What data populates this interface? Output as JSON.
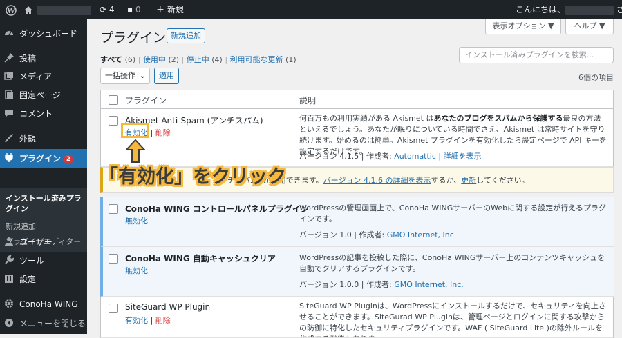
{
  "admin_bar": {
    "updates_count": "4",
    "comments_count": "0",
    "new_label": "新規",
    "greeting": "こんにちは、",
    "honorific": "さん"
  },
  "sidebar": {
    "items": [
      {
        "label": "ダッシュボード",
        "icon": "dashboard-icon"
      },
      {
        "label": "投稿",
        "icon": "pin-icon"
      },
      {
        "label": "メディア",
        "icon": "media-icon"
      },
      {
        "label": "固定ページ",
        "icon": "page-icon"
      },
      {
        "label": "コメント",
        "icon": "comment-icon"
      },
      {
        "label": "外観",
        "icon": "brush-icon"
      },
      {
        "label": "プラグイン",
        "icon": "plugin-icon",
        "badge": "2"
      },
      {
        "label": "ユーザー",
        "icon": "user-icon"
      },
      {
        "label": "ツール",
        "icon": "wrench-icon"
      },
      {
        "label": "設定",
        "icon": "settings-icon"
      },
      {
        "label": "ConoHa WING",
        "icon": "gear-icon"
      },
      {
        "label": "メニューを閉じる",
        "icon": "collapse-icon"
      }
    ],
    "submenu": [
      "インストール済みプラグイン",
      "新規追加",
      "プラグインエディター"
    ]
  },
  "page": {
    "title": "プラグイン",
    "add_new": "新規追加",
    "screen_options": "表示オプション ▼",
    "help": "ヘルプ ▼",
    "search_placeholder": "インストール済みプラグインを検索...",
    "filters": {
      "all": "すべて",
      "all_count": "(6)",
      "active": "使用中",
      "active_count": "(2)",
      "inactive": "停止中",
      "inactive_count": "(4)",
      "updates": "利用可能な更新",
      "updates_count": "(1)"
    },
    "bulk_action": "一括操作",
    "apply": "適用",
    "item_count": "6個の項目"
  },
  "table": {
    "col_plugin": "プラグイン",
    "col_desc": "説明",
    "rows": [
      {
        "name": "Akismet Anti-Spam (アンチスパム)",
        "action": "有効化",
        "delete": "削除",
        "desc_pre": "何百万もの利用実績がある Akismet は",
        "desc_bold": "あなたのブログをスパムから保護する",
        "desc_post": "最良の方法といえるでしょう。あなたが眠りについている時間でさえ、Akismet は常時サイトを守り続けます。始めるのは簡単。Akismet プラグインを有効化したら設定ページで API キーを設定するだけです。",
        "version": "バージョン 4.1.5",
        "author_label": "作成者:",
        "author": "Automattic",
        "details": "詳細を表示"
      },
      {
        "name": "ConoHa WING コントロールパネルプラグイン",
        "action": "無効化",
        "desc": "WordPressの管理画面上で、ConoHa WINGサーバーのWebに関する設定が行えるプラグインです。",
        "version": "バージョン 1.0",
        "author_label": "作成者:",
        "author": "GMO Internet, Inc."
      },
      {
        "name": "ConoHa WING 自動キャッシュクリア",
        "action": "無効化",
        "desc": "WordPressの記事を投稿した際に、ConoHa WINGサーバー上のコンテンツキャッシュを自動でクリアするプラグインです。",
        "version": "バージョン 1.0.0",
        "author_label": "作成者:",
        "author": "GMO Internet, Inc."
      },
      {
        "name": "SiteGuard WP Plugin",
        "action": "有効化",
        "delete": "削除",
        "desc": "SiteGuard WP Pluginは、WordPressにインストールするだけで、セキュリティを向上させることができます。SiteGurad WP Pluginは、管理ページとログインに関する攻撃からの防御に特化したセキュリティプラグインです。WAF ( SiteGuard Lite )の除外ルールを作成する機能もありま"
      }
    ]
  },
  "notice": {
    "pre": "チスパム) が利用できます。",
    "link": "バージョン 4.1.6 の詳細を表示",
    "mid": "するか、",
    "update": "更新",
    "post": "してください。"
  },
  "annotation": {
    "text": "「有効化」をクリック",
    "color": "#f5b83d"
  }
}
